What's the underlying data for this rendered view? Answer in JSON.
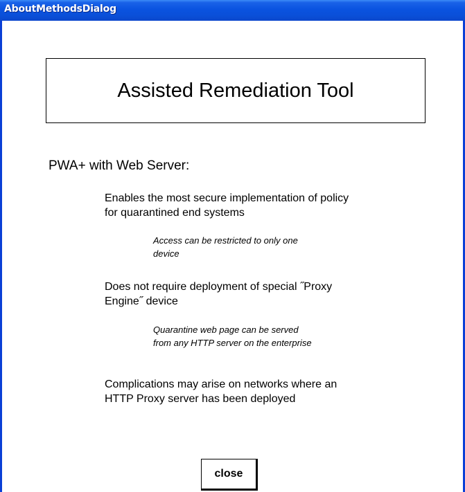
{
  "window": {
    "title": "AboutMethodsDialog"
  },
  "banner": {
    "title": "Assisted Remediation Tool"
  },
  "section": {
    "heading": "PWA+ with Web Server:"
  },
  "points": [
    {
      "lines": [
        "Enables the most secure implementation of policy",
        "for quarantined end systems"
      ]
    },
    {
      "lines": [
        "Does not require deployment of special ˝Proxy",
        "Engine˝ device"
      ]
    },
    {
      "lines": [
        "Complications may arise on networks where an",
        "HTTP Proxy server has been deployed"
      ]
    }
  ],
  "notes": [
    {
      "lines": [
        "Access can be restricted to only one",
        "device"
      ]
    },
    {
      "lines": [
        "Quarantine web page can be served",
        "from any HTTP server on the enterprise"
      ]
    }
  ],
  "buttons": {
    "close_label": "close"
  },
  "colors": {
    "titlebar": "#0a53e0",
    "window_border": "#0a3fd6",
    "background": "#ffffff"
  }
}
